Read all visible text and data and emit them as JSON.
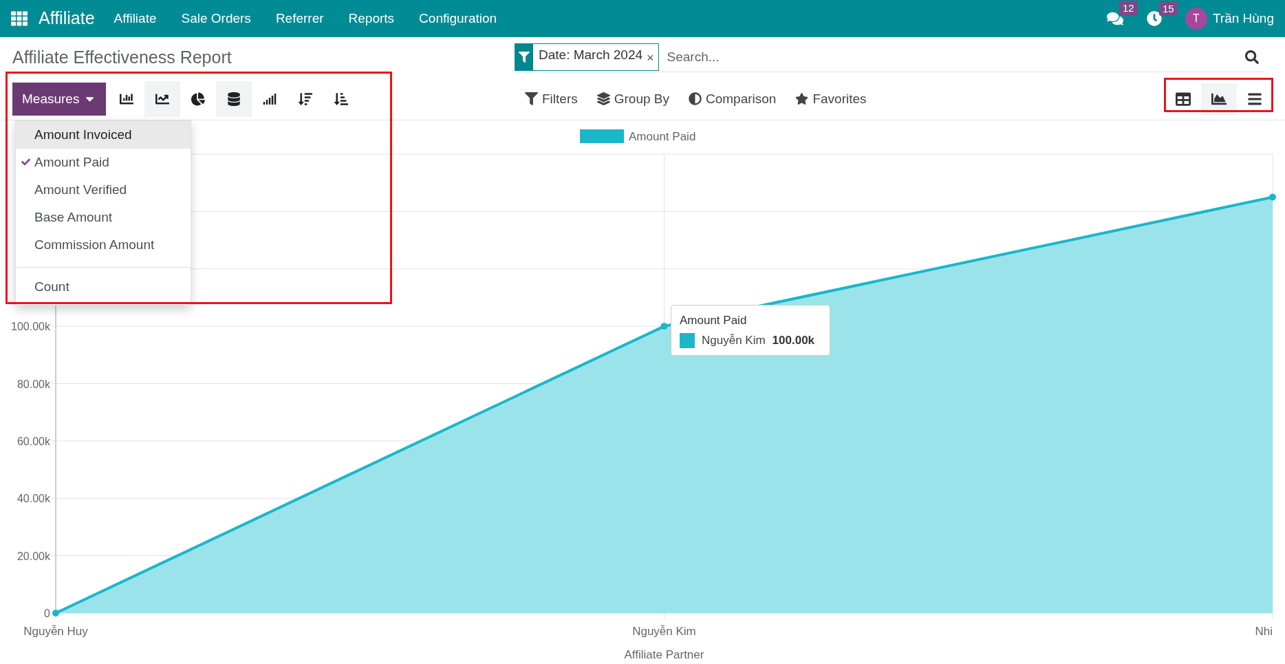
{
  "navbar": {
    "app_name": "Affiliate",
    "menu": [
      "Affiliate",
      "Sale Orders",
      "Referrer",
      "Reports",
      "Configuration"
    ],
    "messages_badge": "12",
    "activities_badge": "15",
    "user": {
      "initial": "T",
      "name": "Trần Hùng"
    }
  },
  "page_title": "Affiliate Effectiveness Report",
  "search": {
    "facet": "Date: March 2024",
    "facet_remove": "×",
    "placeholder": "Search..."
  },
  "measures_button": "Measures",
  "chart_buttons": [
    {
      "kind": "bar",
      "selected": false
    },
    {
      "kind": "line",
      "selected": true
    },
    {
      "kind": "pie",
      "selected": false
    },
    {
      "kind": "stack",
      "selected": true
    },
    {
      "kind": "ascending",
      "selected": false
    },
    {
      "kind": "sort_desc",
      "selected": false
    },
    {
      "kind": "sort_asc",
      "selected": false
    }
  ],
  "search_options": [
    {
      "kind": "filters",
      "label": "Filters"
    },
    {
      "kind": "groupby",
      "label": "Group By"
    },
    {
      "kind": "comparison",
      "label": "Comparison"
    },
    {
      "kind": "favorites",
      "label": "Favorites"
    }
  ],
  "views": [
    {
      "kind": "pivot",
      "selected": false
    },
    {
      "kind": "graph",
      "selected": true
    },
    {
      "kind": "list",
      "selected": false
    }
  ],
  "measures_menu": [
    {
      "label": "Amount Invoiced",
      "checked": false,
      "highlighted": true
    },
    {
      "label": "Amount Paid",
      "checked": true,
      "highlighted": false
    },
    {
      "label": "Amount Verified",
      "checked": false,
      "highlighted": false
    },
    {
      "label": "Base Amount",
      "checked": false,
      "highlighted": false
    },
    {
      "label": "Commission Amount",
      "checked": false,
      "highlighted": false
    },
    {
      "label": "Count",
      "checked": false,
      "highlighted": false,
      "separated": true
    }
  ],
  "chart": {
    "chart_data": {
      "type": "area",
      "xlabel": "Affiliate Partner",
      "categories": [
        "Nguyễn Huy",
        "Nguyễn Kim",
        "Nhi"
      ],
      "series": [
        {
          "name": "Amount Paid",
          "color": "#1ab7c9",
          "values": [
            0,
            100000,
            145000
          ]
        }
      ],
      "ylim": [
        0,
        160000
      ],
      "yticks": [
        {
          "value": 0,
          "label": "0"
        },
        {
          "value": 20000,
          "label": "20.00k"
        },
        {
          "value": 40000,
          "label": "40.00k"
        },
        {
          "value": 60000,
          "label": "60.00k"
        },
        {
          "value": 80000,
          "label": "80.00k"
        },
        {
          "value": 100000,
          "label": "100.00k"
        }
      ],
      "grid": true
    },
    "tooltip": {
      "title": "Amount Paid",
      "label": "Nguyễn Kim",
      "value": "100.00k"
    }
  }
}
